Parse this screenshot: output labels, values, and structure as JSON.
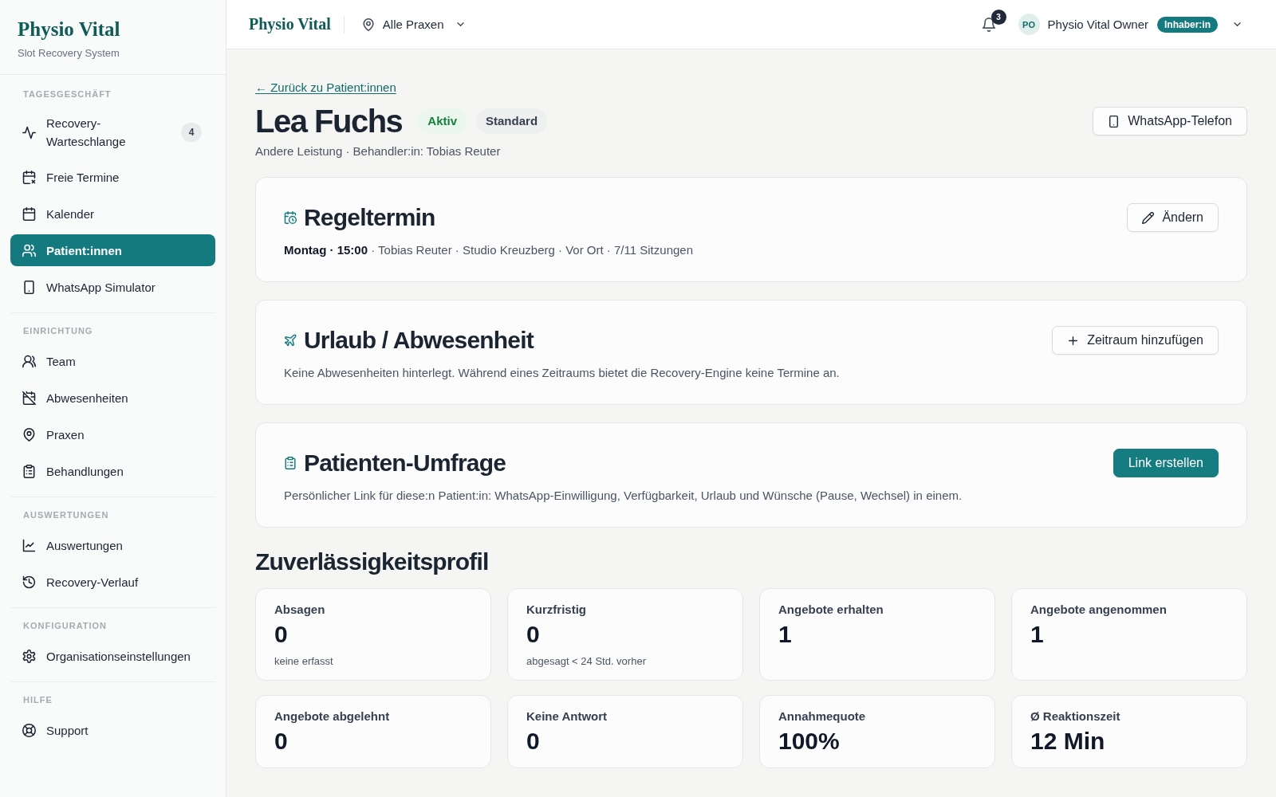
{
  "sidebar": {
    "brand": {
      "title": "Physio Vital",
      "subtitle": "Slot Recovery System"
    },
    "sections": [
      {
        "heading": "TAGESGESCHÄFT",
        "items": [
          {
            "label": "Recovery-Warteschlange",
            "badge": "4",
            "selected": false
          },
          {
            "label": "Freie Termine",
            "selected": false
          },
          {
            "label": "Kalender",
            "selected": false
          },
          {
            "label": "Patient:innen",
            "selected": true
          },
          {
            "label": "WhatsApp Simulator",
            "selected": false
          }
        ]
      },
      {
        "heading": "EINRICHTUNG",
        "items": [
          {
            "label": "Team",
            "selected": false
          },
          {
            "label": "Abwesenheiten",
            "selected": false
          },
          {
            "label": "Praxen",
            "selected": false
          },
          {
            "label": "Behandlungen",
            "selected": false
          }
        ]
      },
      {
        "heading": "AUSWERTUNGEN",
        "items": [
          {
            "label": "Auswertungen",
            "selected": false
          },
          {
            "label": "Recovery-Verlauf",
            "selected": false
          }
        ]
      },
      {
        "heading": "KONFIGURATION",
        "items": [
          {
            "label": "Organisationseinstellungen",
            "selected": false
          }
        ]
      },
      {
        "heading": "HILFE",
        "items": [
          {
            "label": "Support",
            "selected": false
          }
        ]
      }
    ]
  },
  "topbar": {
    "brand": "Physio Vital",
    "location": "Alle Praxen",
    "notifications": "3",
    "user": {
      "initials": "PO",
      "name": "Physio Vital Owner",
      "role": "Inhaber:in"
    }
  },
  "page": {
    "back_link": "← Zurück zu Patient:innen",
    "title": "Lea Fuchs",
    "badges": [
      {
        "label": "Aktiv",
        "kind": "success"
      },
      {
        "label": "Standard",
        "kind": "neutral"
      }
    ],
    "subtitle": "Andere Leistung · Behandler:in: Tobias Reuter",
    "phone_button": "WhatsApp-Telefon"
  },
  "cards": [
    {
      "title": "Regeltermin",
      "text": "**Montag · 15:00** · Tobias Reuter · Studio Kreuzberg · Vor Ort · 7/11 Sitzungen",
      "button": {
        "label": "Ändern",
        "kind": "outline"
      }
    },
    {
      "title": "Urlaub / Abwesenheit",
      "text": "Keine Abwesenheiten hinterlegt. Während eines Zeitraums bietet die Recovery-Engine keine Termine an.",
      "button": {
        "label": "Zeitraum hinzufügen",
        "kind": "outline"
      }
    },
    {
      "title": "Patienten-Umfrage",
      "text": "Persönlicher Link für diese:n Patient:in: WhatsApp-Einwilligung, Verfügbarkeit, Urlaub und Wünsche (Pause, Wechsel) in einem.",
      "button": {
        "label": "Link erstellen",
        "kind": "primary"
      }
    }
  ],
  "profile": {
    "title": "Zuverlässigkeitsprofil",
    "stats": [
      {
        "label": "Absagen",
        "value": "0",
        "note": "keine erfasst"
      },
      {
        "label": "Kurzfristig",
        "value": "0",
        "note": "abgesagt < 24 Std. vorher"
      },
      {
        "label": "Angebote erhalten",
        "value": "1"
      },
      {
        "label": "Angebote angenommen",
        "value": "1"
      },
      {
        "label": "Angebote abgelehnt",
        "value": "0"
      },
      {
        "label": "Keine Antwort",
        "value": "0"
      },
      {
        "label": "Annahmequote",
        "value": "100%"
      },
      {
        "label": "Ø Reaktionszeit",
        "value": "12 Min"
      }
    ]
  }
}
